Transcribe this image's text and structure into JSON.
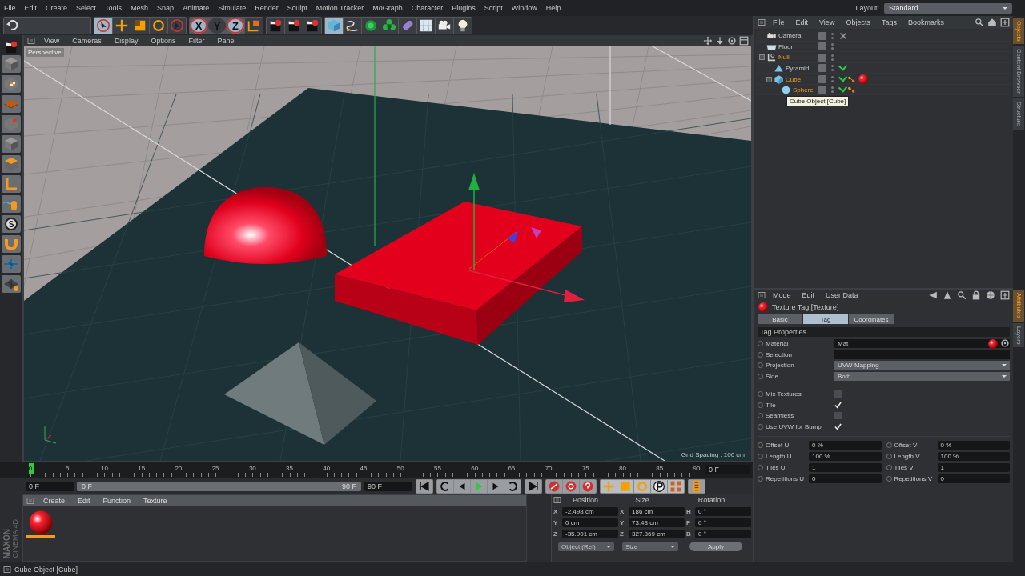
{
  "menu": {
    "items": [
      "File",
      "Edit",
      "Create",
      "Select",
      "Tools",
      "Mesh",
      "Snap",
      "Animate",
      "Simulate",
      "Render",
      "Sculpt",
      "Motion Tracker",
      "MoGraph",
      "Character",
      "Plugins",
      "Script",
      "Window",
      "Help"
    ],
    "layout_label": "Layout:",
    "layout_value": "Standard"
  },
  "toolbar": {
    "axis_buttons": [
      {
        "label": "X",
        "on": true
      },
      {
        "label": "Y",
        "on": false
      },
      {
        "label": "Z",
        "on": true
      }
    ]
  },
  "left_toolbar": {
    "snap_label": "S"
  },
  "viewport": {
    "menu": [
      "View",
      "Cameras",
      "Display",
      "Options",
      "Filter",
      "Panel"
    ],
    "camera": "Perspective",
    "grid_spacing": "Grid Spacing : 100 cm"
  },
  "timeline": {
    "frame_labels": [
      "0",
      "5",
      "10",
      "15",
      "20",
      "25",
      "30",
      "35",
      "40",
      "45",
      "50",
      "55",
      "60",
      "65",
      "70",
      "75",
      "80",
      "85",
      "90"
    ],
    "level": 0,
    "current_field": "0 F"
  },
  "playback": {
    "level": 1,
    "start_field": "0 F",
    "range_start": "0 F",
    "range_end": "90 F",
    "end_field": "90 F"
  },
  "materials": {
    "menu": [
      "Create",
      "Edit",
      "Function",
      "Texture"
    ],
    "items": [
      {
        "selected": true
      }
    ]
  },
  "coordinates": {
    "headers": [
      "Position",
      "Size",
      "Rotation"
    ],
    "rows": [
      {
        "axis": "X",
        "position": "-2.498 cm",
        "size_axis": "X",
        "size": "186 cm",
        "rot_axis": "H",
        "rotation": "0 °"
      },
      {
        "axis": "Y",
        "position": "0 cm",
        "size_axis": "Y",
        "size": "73.43 cm",
        "rot_axis": "P",
        "rotation": "0 °"
      },
      {
        "axis": "Z",
        "position": "-35.901 cm",
        "size_axis": "Z",
        "size": "327.369 cm",
        "rot_axis": "B",
        "rotation": "0 °"
      }
    ],
    "mode": "Object (Rel)",
    "size_mode": "Size",
    "apply": "Apply"
  },
  "logo": {
    "brand": "MAXON",
    "product": "CINEMA 4D"
  },
  "status_bar": "Cube Object [Cube]",
  "objects": {
    "menu": [
      "File",
      "Edit",
      "View",
      "Objects",
      "Tags",
      "Bookmarks"
    ],
    "tree": [
      {
        "name": "Camera",
        "kind": "camera",
        "selected": false,
        "tags": [
          {
            "kind": "target"
          }
        ]
      },
      {
        "name": "Floor",
        "kind": "floor",
        "selected": false
      },
      {
        "name": "Null",
        "kind": "null",
        "selected": true,
        "expanded": true,
        "children": [
          {
            "name": "Pyramid",
            "kind": "pyramid",
            "selected": false,
            "checked": true
          },
          {
            "name": "Cube",
            "kind": "cube",
            "selected": true,
            "checked": true,
            "tags": [
              {
                "kind": "phong"
              },
              {
                "kind": "texture"
              }
            ],
            "expanded": true,
            "children": [
              {
                "name": "Sphere",
                "kind": "sphere",
                "selected": true,
                "checked": true,
                "tags": [
                  {
                    "kind": "phong"
                  }
                ]
              }
            ]
          }
        ]
      }
    ],
    "tooltip": "Cube Object [Cube]"
  },
  "right_tabs_top": [
    {
      "label": "Objects",
      "selected": true
    },
    {
      "label": "Content Browser",
      "selected": false
    },
    {
      "label": "Structure",
      "selected": false
    }
  ],
  "right_tabs_bottom": [
    {
      "label": "Attributes",
      "selected": true
    },
    {
      "label": "Layers",
      "selected": false
    }
  ],
  "attributes": {
    "menu": [
      "Mode",
      "Edit",
      "User Data"
    ],
    "title": "Texture Tag [Texture]",
    "tabs": [
      {
        "label": "Basic",
        "selected": false
      },
      {
        "label": "Tag",
        "selected": true
      },
      {
        "label": "Coordinates",
        "selected": false
      }
    ],
    "section": "Tag Properties",
    "properties": [
      {
        "kind": "link",
        "label": "Material",
        "value": "Mat"
      },
      {
        "kind": "link",
        "label": "Selection"
      },
      {
        "kind": "dropdown",
        "label": "Projection",
        "value": "UVW Mapping"
      },
      {
        "kind": "dropdown",
        "label": "Side",
        "value": "Both"
      },
      {
        "kind": "checkbox",
        "label": "Mix Textures",
        "checked": false
      },
      {
        "kind": "checkbox",
        "label": "Tile",
        "checked": true
      },
      {
        "kind": "checkbox",
        "label": "Seamless",
        "checked": false
      },
      {
        "kind": "checkbox",
        "label": "Use UVW for Bump",
        "checked": true
      }
    ],
    "uv_params": [
      {
        "label": "Offset U",
        "value": "0 %"
      },
      {
        "label": "Offset V",
        "value": "0 %"
      },
      {
        "label": "Length U",
        "value": "100 %"
      },
      {
        "label": "Length V",
        "value": "100 %"
      },
      {
        "label": "Tiles U",
        "value": "1"
      },
      {
        "label": "Tiles V",
        "value": "1"
      },
      {
        "label": "Repetitions U",
        "value": "0"
      },
      {
        "label": "Repetitions V",
        "value": "0"
      }
    ]
  }
}
